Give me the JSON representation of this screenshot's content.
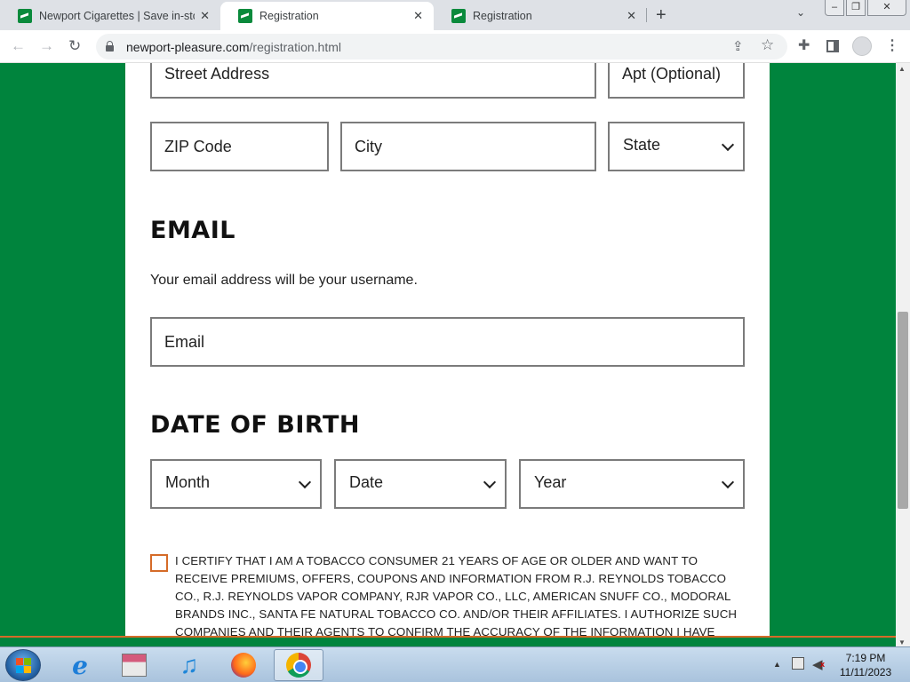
{
  "browser": {
    "tabs": [
      {
        "title": "Newport Cigarettes | Save in-store",
        "close": "✕"
      },
      {
        "title": "Registration",
        "close": "✕"
      },
      {
        "title": "Registration",
        "close": "✕"
      }
    ],
    "new_tab": "+",
    "tab_search": "⌄",
    "window_controls": {
      "minimize": "–",
      "maximize": "❐",
      "close": "✕"
    },
    "nav": {
      "back": "←",
      "forward": "→",
      "reload": "↻"
    },
    "url_host": "newport-pleasure.com",
    "url_path": "/registration.html",
    "icons": [
      "lock-icon",
      "share-icon",
      "star-icon",
      "extensions-icon",
      "side-panel-icon",
      "profile-icon",
      "menu-icon"
    ],
    "share_glyph": "⇪",
    "star_glyph": "☆",
    "extensions_glyph": "✚",
    "menu_glyph": "⋮"
  },
  "form": {
    "street_placeholder": "Street Address",
    "apt_placeholder": "Apt (Optional)",
    "zip_placeholder": "ZIP Code",
    "city_placeholder": "City",
    "state_select": "State",
    "email_heading": "EMAIL",
    "email_helper": "Your email address will be your username.",
    "email_placeholder": "Email",
    "dob_heading": "DATE OF BIRTH",
    "month_select": "Month",
    "date_select": "Date",
    "year_select": "Year",
    "consent_text": "I CERTIFY THAT I AM A TOBACCO CONSUMER 21 YEARS OF AGE OR OLDER AND WANT TO RECEIVE PREMIUMS, OFFERS, COUPONS AND INFORMATION FROM R.J. REYNOLDS TOBACCO CO., R.J. REYNOLDS VAPOR COMPANY, RJR VAPOR CO., LLC, AMERICAN SNUFF CO., MODORAL BRANDS INC., SANTA FE NATURAL TOBACCO CO. AND/OR THEIR AFFILIATES. I AUTHORIZE SUCH COMPANIES AND THEIR AGENTS TO CONFIRM THE ACCURACY OF THE INFORMATION I HAVE"
  },
  "scrollbar": {
    "up": "▲",
    "down": "▼"
  },
  "colors": {
    "brand_green": "#00843d",
    "accent_orange": "#d56b28"
  },
  "taskbar": {
    "apps": [
      "start-button",
      "internet-explorer-icon",
      "store-icon",
      "music-icon",
      "firefox-icon",
      "chrome-icon"
    ],
    "music_glyph": "♫",
    "ie_glyph": "e",
    "tray_arrow": "▲",
    "volume_glyph": "◀",
    "time": "7:19 PM",
    "date": "11/11/2023"
  }
}
